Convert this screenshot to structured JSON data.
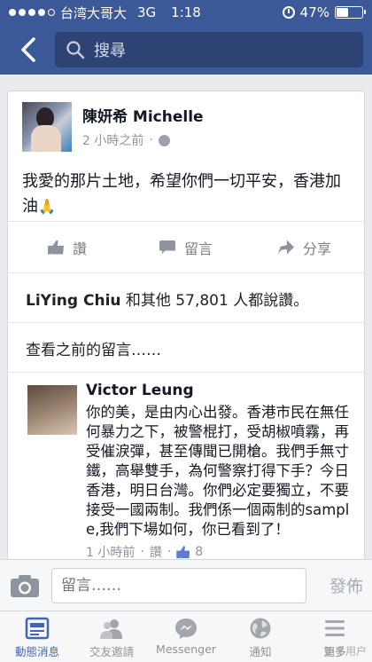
{
  "status_bar": {
    "carrier": "台湾大哥大",
    "network": "3G",
    "time": "1:18",
    "battery": "47%",
    "battery_level": 0.47
  },
  "nav": {
    "search_placeholder": "搜尋"
  },
  "post": {
    "author": "陳妍希 Michelle",
    "time": "2 小時之前",
    "text": "我愛的那片土地，希望你們一切平安，香港加油",
    "actions": {
      "like": "讚",
      "comment": "留言",
      "share": "分享"
    },
    "likes_name": "LiYing Chiu",
    "likes_rest": " 和其他 57,801 人都說讚。",
    "view_previous": "查看之前的留言……"
  },
  "comment": {
    "author": "Victor Leung",
    "text": "你的美，是由内心出發。香港市民在無任何暴力之下，被警棍打，受胡椒噴霧，再受催淚彈，甚至傳聞已開槍。我們手無寸鐵，高舉雙手，為何警察打得下手？今日香港，明日台灣。你們必定要獨立，不要接受一國兩制。我們係一個兩制的sample,我們下場如何，你已看到了！",
    "time": "1 小時前",
    "like": "讚",
    "like_count": "8"
  },
  "composer": {
    "placeholder": "留言……",
    "send": "發佈"
  },
  "tabs": [
    {
      "label": "動態消息",
      "icon": "news-feed-icon",
      "active": true
    },
    {
      "label": "交友邀請",
      "icon": "friend-requests-icon",
      "active": false
    },
    {
      "label": "Messenger",
      "icon": "messenger-icon",
      "active": false
    },
    {
      "label": "通知",
      "icon": "notifications-globe-icon",
      "active": false
    },
    {
      "label": "更多",
      "icon": "more-menu-icon",
      "active": false
    }
  ],
  "watermark": "知乎用户",
  "colors": {
    "brand": "#3b5998",
    "active_tab": "#4267b2"
  }
}
